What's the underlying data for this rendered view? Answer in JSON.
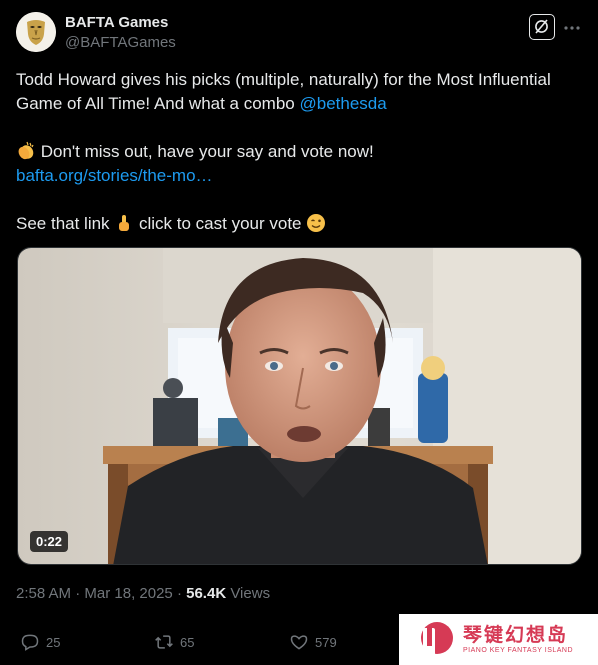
{
  "author": {
    "display_name": "BAFTA Games",
    "handle": "@BAFTAGames"
  },
  "tweet": {
    "line1_prefix": "Todd Howard gives his picks (multiple, naturally) for the Most Influential Game of All Time! And what a combo ",
    "mention": "@bethesda",
    "line2": "Don't miss out, have your say and vote now!",
    "link": "bafta.org/stories/the-mo…",
    "line3_prefix": "See that link ",
    "line3_suffix": " click to cast your vote "
  },
  "media": {
    "duration": "0:22"
  },
  "meta": {
    "time": "2:58 AM",
    "separator": " · ",
    "date": "Mar 18, 2025",
    "views_count": "56.4K",
    "views_label": " Views"
  },
  "actions": {
    "replies": "25",
    "reposts": "65",
    "likes": "579"
  },
  "watermark": {
    "title": "琴键幻想岛",
    "subtitle": "PIANO KEY FANTASY ISLAND"
  },
  "icons": {
    "avatar": "bafta-mask-icon",
    "grok": "grok-icon",
    "more": "more-icon",
    "reply": "reply-icon",
    "repost": "repost-icon",
    "like": "like-icon"
  }
}
